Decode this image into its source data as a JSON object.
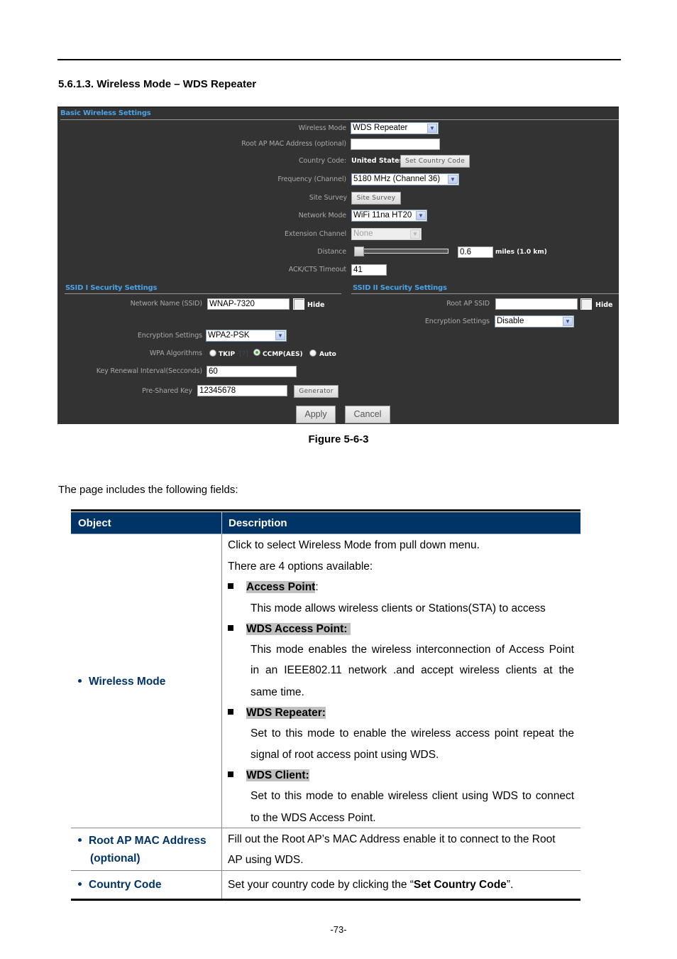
{
  "document": {
    "section_title": "5.6.1.3.  Wireless Mode – WDS Repeater",
    "figure_caption": "Figure 5-6-3",
    "intro_text": "The page includes the following fields:",
    "page_number": "-73-"
  },
  "screenshot": {
    "basic_header": "Basic Wireless Settings",
    "fields": {
      "wireless_mode": {
        "label": "Wireless Mode",
        "value": "WDS Repeater"
      },
      "root_ap_mac": {
        "label": "Root AP MAC Address (optional)",
        "value": ""
      },
      "country_code": {
        "label": "Country Code:",
        "value": "United States",
        "button": "Set Country Code"
      },
      "frequency": {
        "label": "Frequency (Channel)",
        "value": "5180 MHz (Channel 36)"
      },
      "site_survey": {
        "label": "Site Survey",
        "button": "Site Survey"
      },
      "network_mode": {
        "label": "Network Mode",
        "value": "WiFi 11na HT20"
      },
      "extension_channel": {
        "label": "Extension Channel",
        "value": "None",
        "disabled": true
      },
      "distance": {
        "label": "Distance",
        "value": "0.6",
        "unit": "miles (1.0 km)",
        "slider_fraction": 0.0
      },
      "ack_timeout": {
        "label": "ACK/CTS Timeout",
        "value": "41"
      }
    },
    "ssid1": {
      "header": "SSID I Security Settings",
      "network_name_label": "Network Name (SSID)",
      "network_name_value": "WNAP-7320",
      "hide_label": "Hide",
      "hide_checked": false,
      "encryption_label": "Encryption Settings",
      "encryption_value": "WPA2-PSK",
      "wpa_label": "WPA Algorithms",
      "wpa_options": [
        {
          "label": "TKIP",
          "checked": false
        },
        {
          "label": "CCMP(AES)",
          "checked": true
        },
        {
          "label": "Auto",
          "checked": false
        }
      ],
      "wpa_help": "[?]",
      "key_renewal_label": "Key Renewal Interval(Secconds)",
      "key_renewal_value": "60",
      "psk_label": "Pre-Shared Key",
      "psk_value": "12345678",
      "generator_button": "Generator"
    },
    "ssid2": {
      "header": "SSID II Security Settings",
      "root_ssid_label": "Root AP SSID",
      "root_ssid_value": "",
      "hide_label": "Hide",
      "hide_checked": false,
      "encryption_label": "Encryption Settings",
      "encryption_value": "Disable"
    },
    "apply_button": "Apply",
    "cancel_button": "Cancel"
  },
  "table": {
    "headers": {
      "object": "Object",
      "description": "Description"
    },
    "rows": [
      {
        "object": "Wireless Mode",
        "intro": [
          "Click to select Wireless Mode from pull down menu.",
          "There are 4 options available:"
        ],
        "options": [
          {
            "title": "Access Point",
            "suffix": ":",
            "lines": [
              "This mode allows wireless clients or Stations(STA) to access"
            ]
          },
          {
            "title": "WDS Access Point:",
            "suffix": "",
            "lines": [
              "This mode enables the wireless interconnection of Access Point",
              "in an IEEE802.11 network .and accept wireless clients at the",
              "same time."
            ]
          },
          {
            "title": "WDS Repeater:",
            "suffix": "",
            "lines": [
              "Set to this mode to enable the wireless access point repeat the",
              "signal of root access point using WDS."
            ]
          },
          {
            "title": "WDS Client:",
            "suffix": "",
            "lines": [
              "Set to this mode to enable wireless client using WDS to connect",
              "to the WDS Access Point."
            ]
          }
        ]
      },
      {
        "object_line1": "Root AP MAC Address",
        "object_line2": "(optional)",
        "lines": [
          "Fill out the Root AP’s MAC Address enable it to connect to the Root",
          "AP using WDS."
        ]
      },
      {
        "object": "Country Code",
        "text_before": "Set your country code by clicking the “",
        "text_bold": "Set Country Code",
        "text_after": "”."
      }
    ]
  },
  "colors": {
    "panel_bg": "#333333",
    "panel_header": "#4aa3e6",
    "table_header_bg": "#003366",
    "object_text": "#003366"
  }
}
